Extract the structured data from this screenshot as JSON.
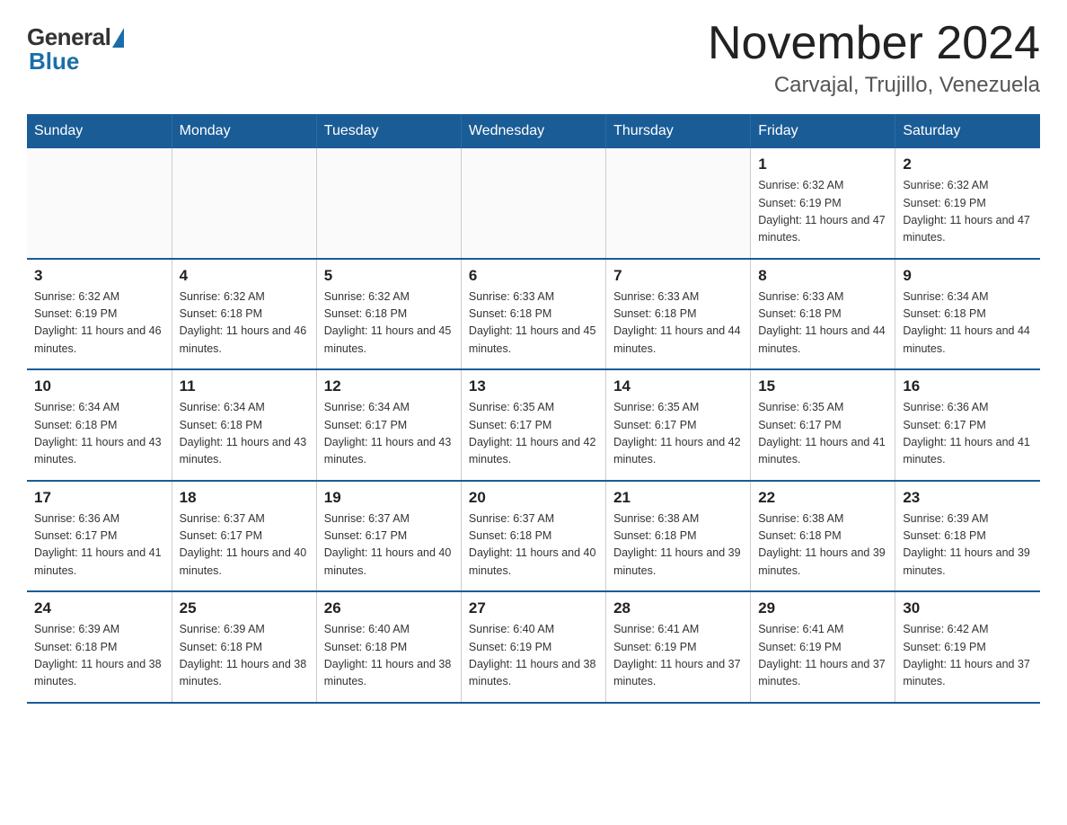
{
  "header": {
    "logo_general": "General",
    "logo_blue": "Blue",
    "month_title": "November 2024",
    "location": "Carvajal, Trujillo, Venezuela"
  },
  "weekdays": [
    "Sunday",
    "Monday",
    "Tuesday",
    "Wednesday",
    "Thursday",
    "Friday",
    "Saturday"
  ],
  "weeks": [
    [
      {
        "day": "",
        "info": ""
      },
      {
        "day": "",
        "info": ""
      },
      {
        "day": "",
        "info": ""
      },
      {
        "day": "",
        "info": ""
      },
      {
        "day": "",
        "info": ""
      },
      {
        "day": "1",
        "info": "Sunrise: 6:32 AM\nSunset: 6:19 PM\nDaylight: 11 hours and 47 minutes."
      },
      {
        "day": "2",
        "info": "Sunrise: 6:32 AM\nSunset: 6:19 PM\nDaylight: 11 hours and 47 minutes."
      }
    ],
    [
      {
        "day": "3",
        "info": "Sunrise: 6:32 AM\nSunset: 6:19 PM\nDaylight: 11 hours and 46 minutes."
      },
      {
        "day": "4",
        "info": "Sunrise: 6:32 AM\nSunset: 6:18 PM\nDaylight: 11 hours and 46 minutes."
      },
      {
        "day": "5",
        "info": "Sunrise: 6:32 AM\nSunset: 6:18 PM\nDaylight: 11 hours and 45 minutes."
      },
      {
        "day": "6",
        "info": "Sunrise: 6:33 AM\nSunset: 6:18 PM\nDaylight: 11 hours and 45 minutes."
      },
      {
        "day": "7",
        "info": "Sunrise: 6:33 AM\nSunset: 6:18 PM\nDaylight: 11 hours and 44 minutes."
      },
      {
        "day": "8",
        "info": "Sunrise: 6:33 AM\nSunset: 6:18 PM\nDaylight: 11 hours and 44 minutes."
      },
      {
        "day": "9",
        "info": "Sunrise: 6:34 AM\nSunset: 6:18 PM\nDaylight: 11 hours and 44 minutes."
      }
    ],
    [
      {
        "day": "10",
        "info": "Sunrise: 6:34 AM\nSunset: 6:18 PM\nDaylight: 11 hours and 43 minutes."
      },
      {
        "day": "11",
        "info": "Sunrise: 6:34 AM\nSunset: 6:18 PM\nDaylight: 11 hours and 43 minutes."
      },
      {
        "day": "12",
        "info": "Sunrise: 6:34 AM\nSunset: 6:17 PM\nDaylight: 11 hours and 43 minutes."
      },
      {
        "day": "13",
        "info": "Sunrise: 6:35 AM\nSunset: 6:17 PM\nDaylight: 11 hours and 42 minutes."
      },
      {
        "day": "14",
        "info": "Sunrise: 6:35 AM\nSunset: 6:17 PM\nDaylight: 11 hours and 42 minutes."
      },
      {
        "day": "15",
        "info": "Sunrise: 6:35 AM\nSunset: 6:17 PM\nDaylight: 11 hours and 41 minutes."
      },
      {
        "day": "16",
        "info": "Sunrise: 6:36 AM\nSunset: 6:17 PM\nDaylight: 11 hours and 41 minutes."
      }
    ],
    [
      {
        "day": "17",
        "info": "Sunrise: 6:36 AM\nSunset: 6:17 PM\nDaylight: 11 hours and 41 minutes."
      },
      {
        "day": "18",
        "info": "Sunrise: 6:37 AM\nSunset: 6:17 PM\nDaylight: 11 hours and 40 minutes."
      },
      {
        "day": "19",
        "info": "Sunrise: 6:37 AM\nSunset: 6:17 PM\nDaylight: 11 hours and 40 minutes."
      },
      {
        "day": "20",
        "info": "Sunrise: 6:37 AM\nSunset: 6:18 PM\nDaylight: 11 hours and 40 minutes."
      },
      {
        "day": "21",
        "info": "Sunrise: 6:38 AM\nSunset: 6:18 PM\nDaylight: 11 hours and 39 minutes."
      },
      {
        "day": "22",
        "info": "Sunrise: 6:38 AM\nSunset: 6:18 PM\nDaylight: 11 hours and 39 minutes."
      },
      {
        "day": "23",
        "info": "Sunrise: 6:39 AM\nSunset: 6:18 PM\nDaylight: 11 hours and 39 minutes."
      }
    ],
    [
      {
        "day": "24",
        "info": "Sunrise: 6:39 AM\nSunset: 6:18 PM\nDaylight: 11 hours and 38 minutes."
      },
      {
        "day": "25",
        "info": "Sunrise: 6:39 AM\nSunset: 6:18 PM\nDaylight: 11 hours and 38 minutes."
      },
      {
        "day": "26",
        "info": "Sunrise: 6:40 AM\nSunset: 6:18 PM\nDaylight: 11 hours and 38 minutes."
      },
      {
        "day": "27",
        "info": "Sunrise: 6:40 AM\nSunset: 6:19 PM\nDaylight: 11 hours and 38 minutes."
      },
      {
        "day": "28",
        "info": "Sunrise: 6:41 AM\nSunset: 6:19 PM\nDaylight: 11 hours and 37 minutes."
      },
      {
        "day": "29",
        "info": "Sunrise: 6:41 AM\nSunset: 6:19 PM\nDaylight: 11 hours and 37 minutes."
      },
      {
        "day": "30",
        "info": "Sunrise: 6:42 AM\nSunset: 6:19 PM\nDaylight: 11 hours and 37 minutes."
      }
    ]
  ]
}
